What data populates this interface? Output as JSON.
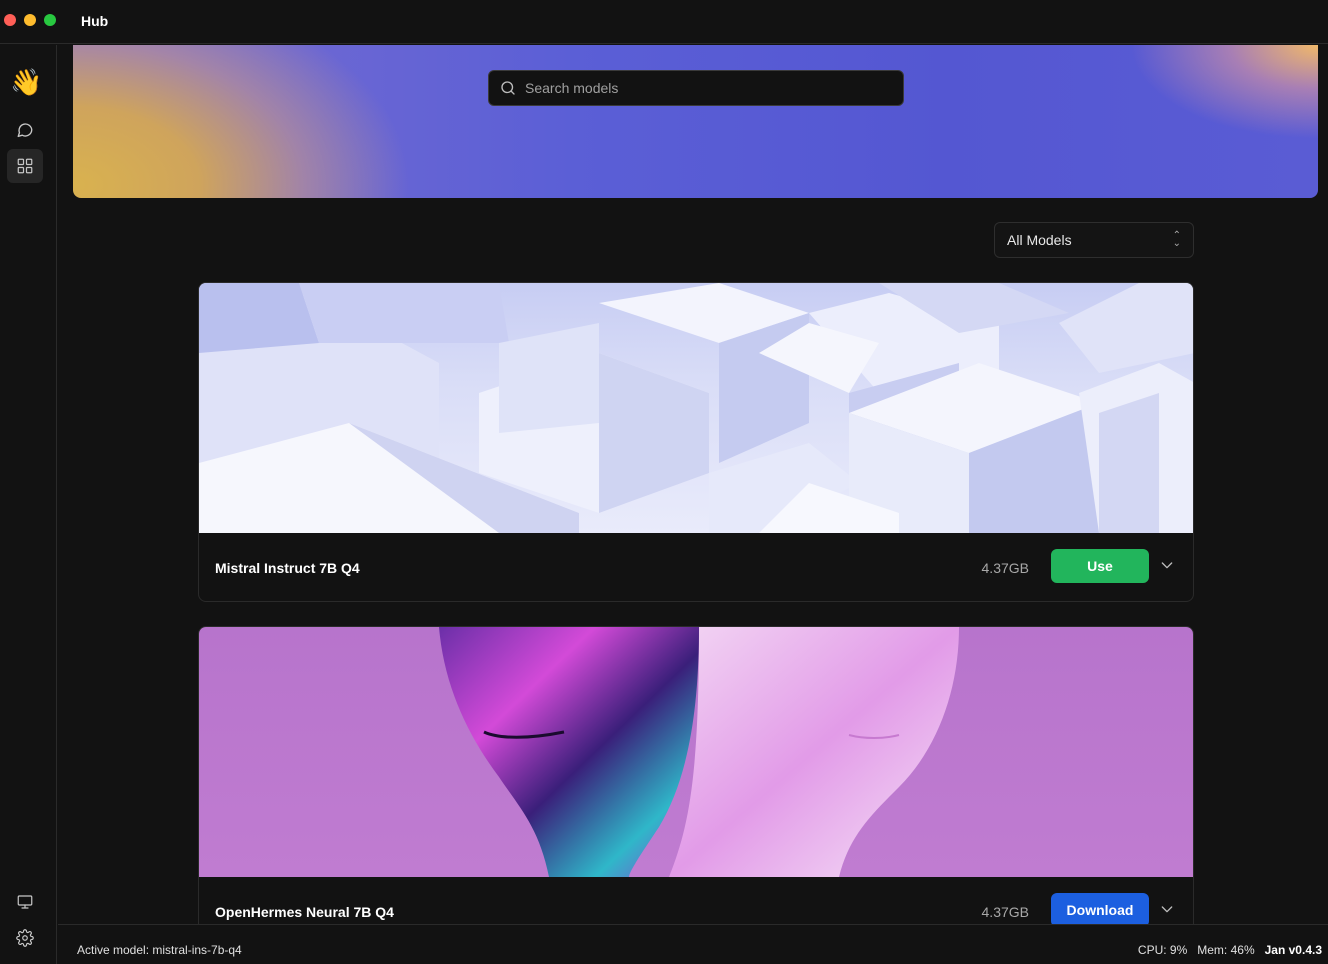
{
  "app": {
    "title": "Hub"
  },
  "sidebar": {
    "logo": "👋",
    "items": [
      {
        "name": "chat",
        "icon": "chat-bubble-icon",
        "active": false
      },
      {
        "name": "hub",
        "icon": "grid-icon",
        "active": true
      }
    ],
    "bottom": [
      {
        "name": "system-monitor",
        "icon": "monitor-icon"
      },
      {
        "name": "settings",
        "icon": "gear-icon"
      }
    ]
  },
  "search": {
    "placeholder": "Search models"
  },
  "filter": {
    "selected": "All Models"
  },
  "models": [
    {
      "name": "Mistral Instruct 7B Q4",
      "size": "4.37GB",
      "action": "Use",
      "action_color": "#22b55c"
    },
    {
      "name": "OpenHermes Neural 7B Q4",
      "size": "4.37GB",
      "action": "Download",
      "action_color": "#1c5fe0"
    }
  ],
  "status": {
    "active_model": "Active model: mistral-ins-7b-q4",
    "cpu": "CPU: 9%",
    "mem": "Mem: 46%",
    "version": "Jan v0.4.3"
  },
  "colors": {
    "accent_green": "#22b55c",
    "accent_blue": "#1c5fe0",
    "background": "#121212"
  }
}
